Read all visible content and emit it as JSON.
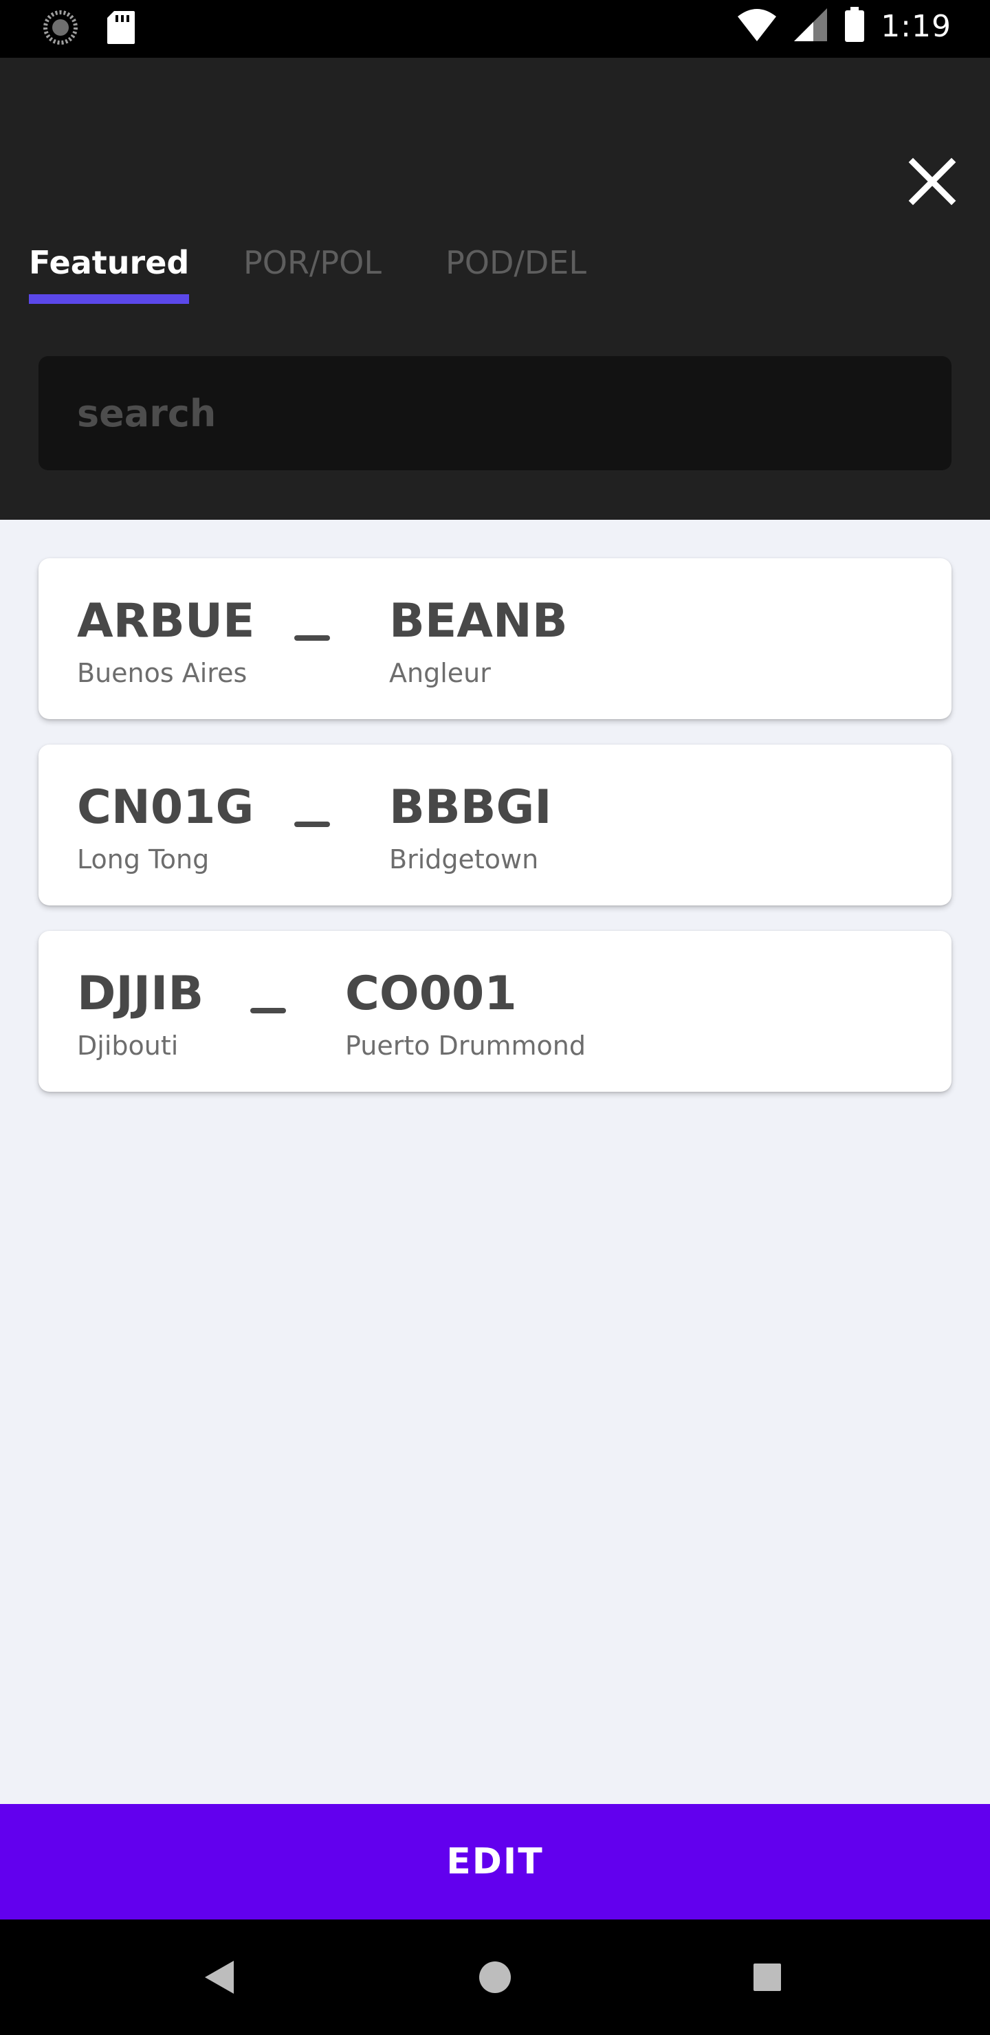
{
  "status_bar": {
    "time": "1:19",
    "icons": [
      "sync-icon",
      "sd-card-icon",
      "wifi-icon",
      "signal-icon",
      "battery-icon"
    ]
  },
  "tabs": [
    {
      "label": "Featured",
      "active": true
    },
    {
      "label": "POR/POL",
      "active": false
    },
    {
      "label": "POD/DEL",
      "active": false
    }
  ],
  "search": {
    "placeholder": "search"
  },
  "routes": [
    {
      "from_code": "ARBUE",
      "from_city": "Buenos Aires",
      "to_code": "BEANB",
      "to_city": "Angleur"
    },
    {
      "from_code": "CN01G",
      "from_city": "Long Tong",
      "to_code": "BBBGI",
      "to_city": "Bridgetown"
    },
    {
      "from_code": "DJJIB",
      "from_city": "Djibouti",
      "to_code": "CO001",
      "to_city": "Puerto Drummond"
    }
  ],
  "edit_button": {
    "label": "EDIT"
  },
  "colors": {
    "accent": "#6200ee",
    "tab_indicator": "#5b48ea",
    "header_bg": "#212121",
    "page_bg": "#f0f2f8"
  },
  "nav_bar": {
    "icons": [
      "back-icon",
      "home-icon",
      "recents-icon"
    ]
  }
}
